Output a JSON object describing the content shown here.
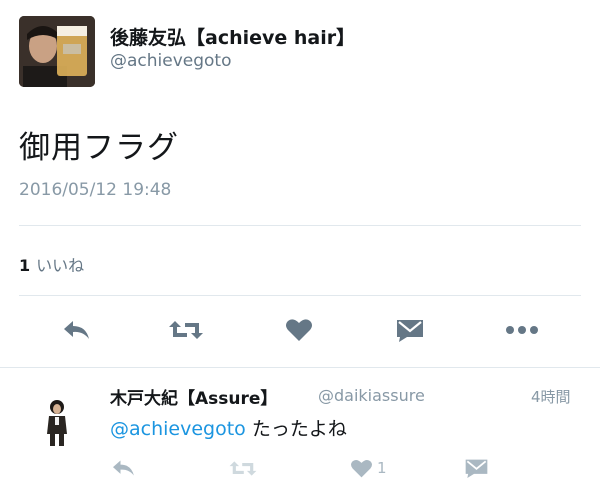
{
  "author": {
    "display_name": "後藤友弘【achieve hair】",
    "handle": "@achievegoto"
  },
  "tweet": {
    "text": "御用フラグ",
    "timestamp": "2016/05/12 19:48",
    "like_count": "1",
    "like_label": "いいね"
  },
  "actions": {
    "icons": [
      "reply-icon",
      "retweet-icon",
      "heart-icon",
      "message-icon",
      "more-icon"
    ]
  },
  "reply": {
    "display_name": "木戸大紀【Assure】",
    "handle": "@daikiassure",
    "time": "4時間",
    "mention": "@achievegoto",
    "text": "たったよね",
    "like_count": "1"
  },
  "colors": {
    "icon_gray": "#657786",
    "icon_light": "#aab8c2",
    "link_blue": "#1b95e0",
    "divider": "#e1e8ed"
  }
}
